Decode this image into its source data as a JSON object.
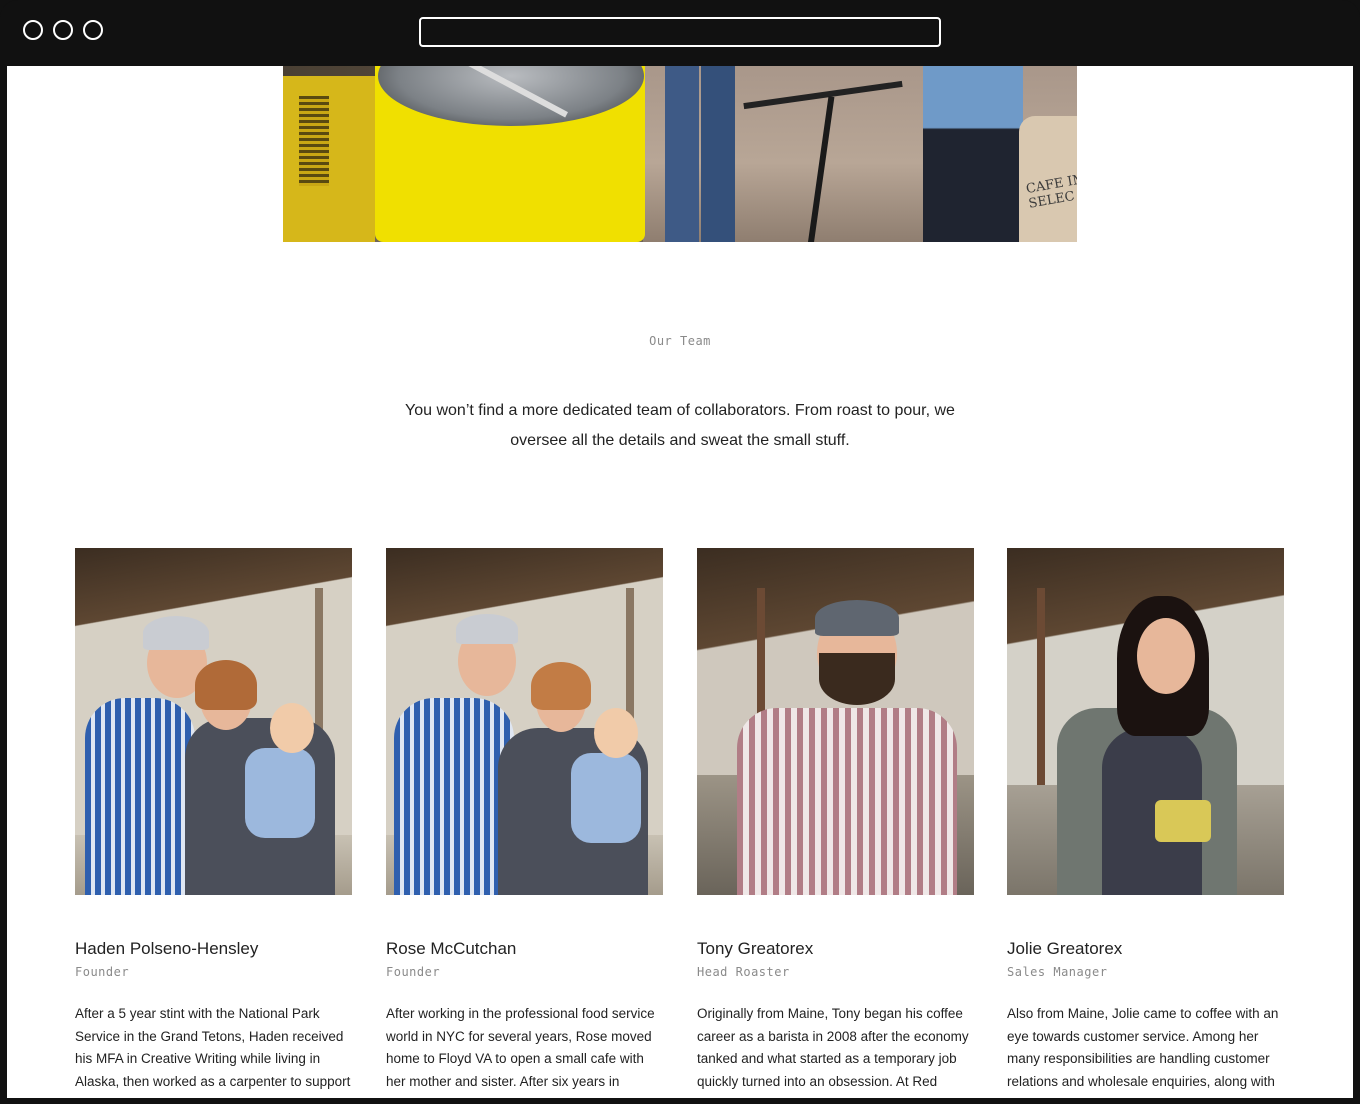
{
  "browser": {
    "address": ""
  },
  "hero": {
    "sack_text": "CAFE IMP\nSELEC"
  },
  "section": {
    "eyebrow": "Our Team",
    "lead": "You won’t find a more dedicated team of collaborators. From roast to pour, we oversee all the details and sweat the small stuff."
  },
  "team": [
    {
      "name": "Haden Polseno-Hensley",
      "role": "Founder",
      "bio": "After a 5 year stint with the National Park Service in the Grand Tetons, Haden received his MFA in Creative Writing while living in Alaska, then worked as a carpenter to support"
    },
    {
      "name": "Rose McCutchan",
      "role": "Founder",
      "bio": "After working in the professional food service world in NYC for several years, Rose moved home to Floyd VA to open a small cafe with her mother and sister. After six years in business,"
    },
    {
      "name": "Tony Greatorex",
      "role": "Head Roaster",
      "bio": "Originally from Maine, Tony began his coffee career as a barista in 2008 after the economy tanked and what started as a temporary job quickly turned into an obsession. At Red"
    },
    {
      "name": "Jolie Greatorex",
      "role": "Sales Manager",
      "bio": "Also from Maine, Jolie came to coffee with an eye towards customer service. Among her many responsibilities are handling customer relations and wholesale enquiries, along with"
    }
  ]
}
